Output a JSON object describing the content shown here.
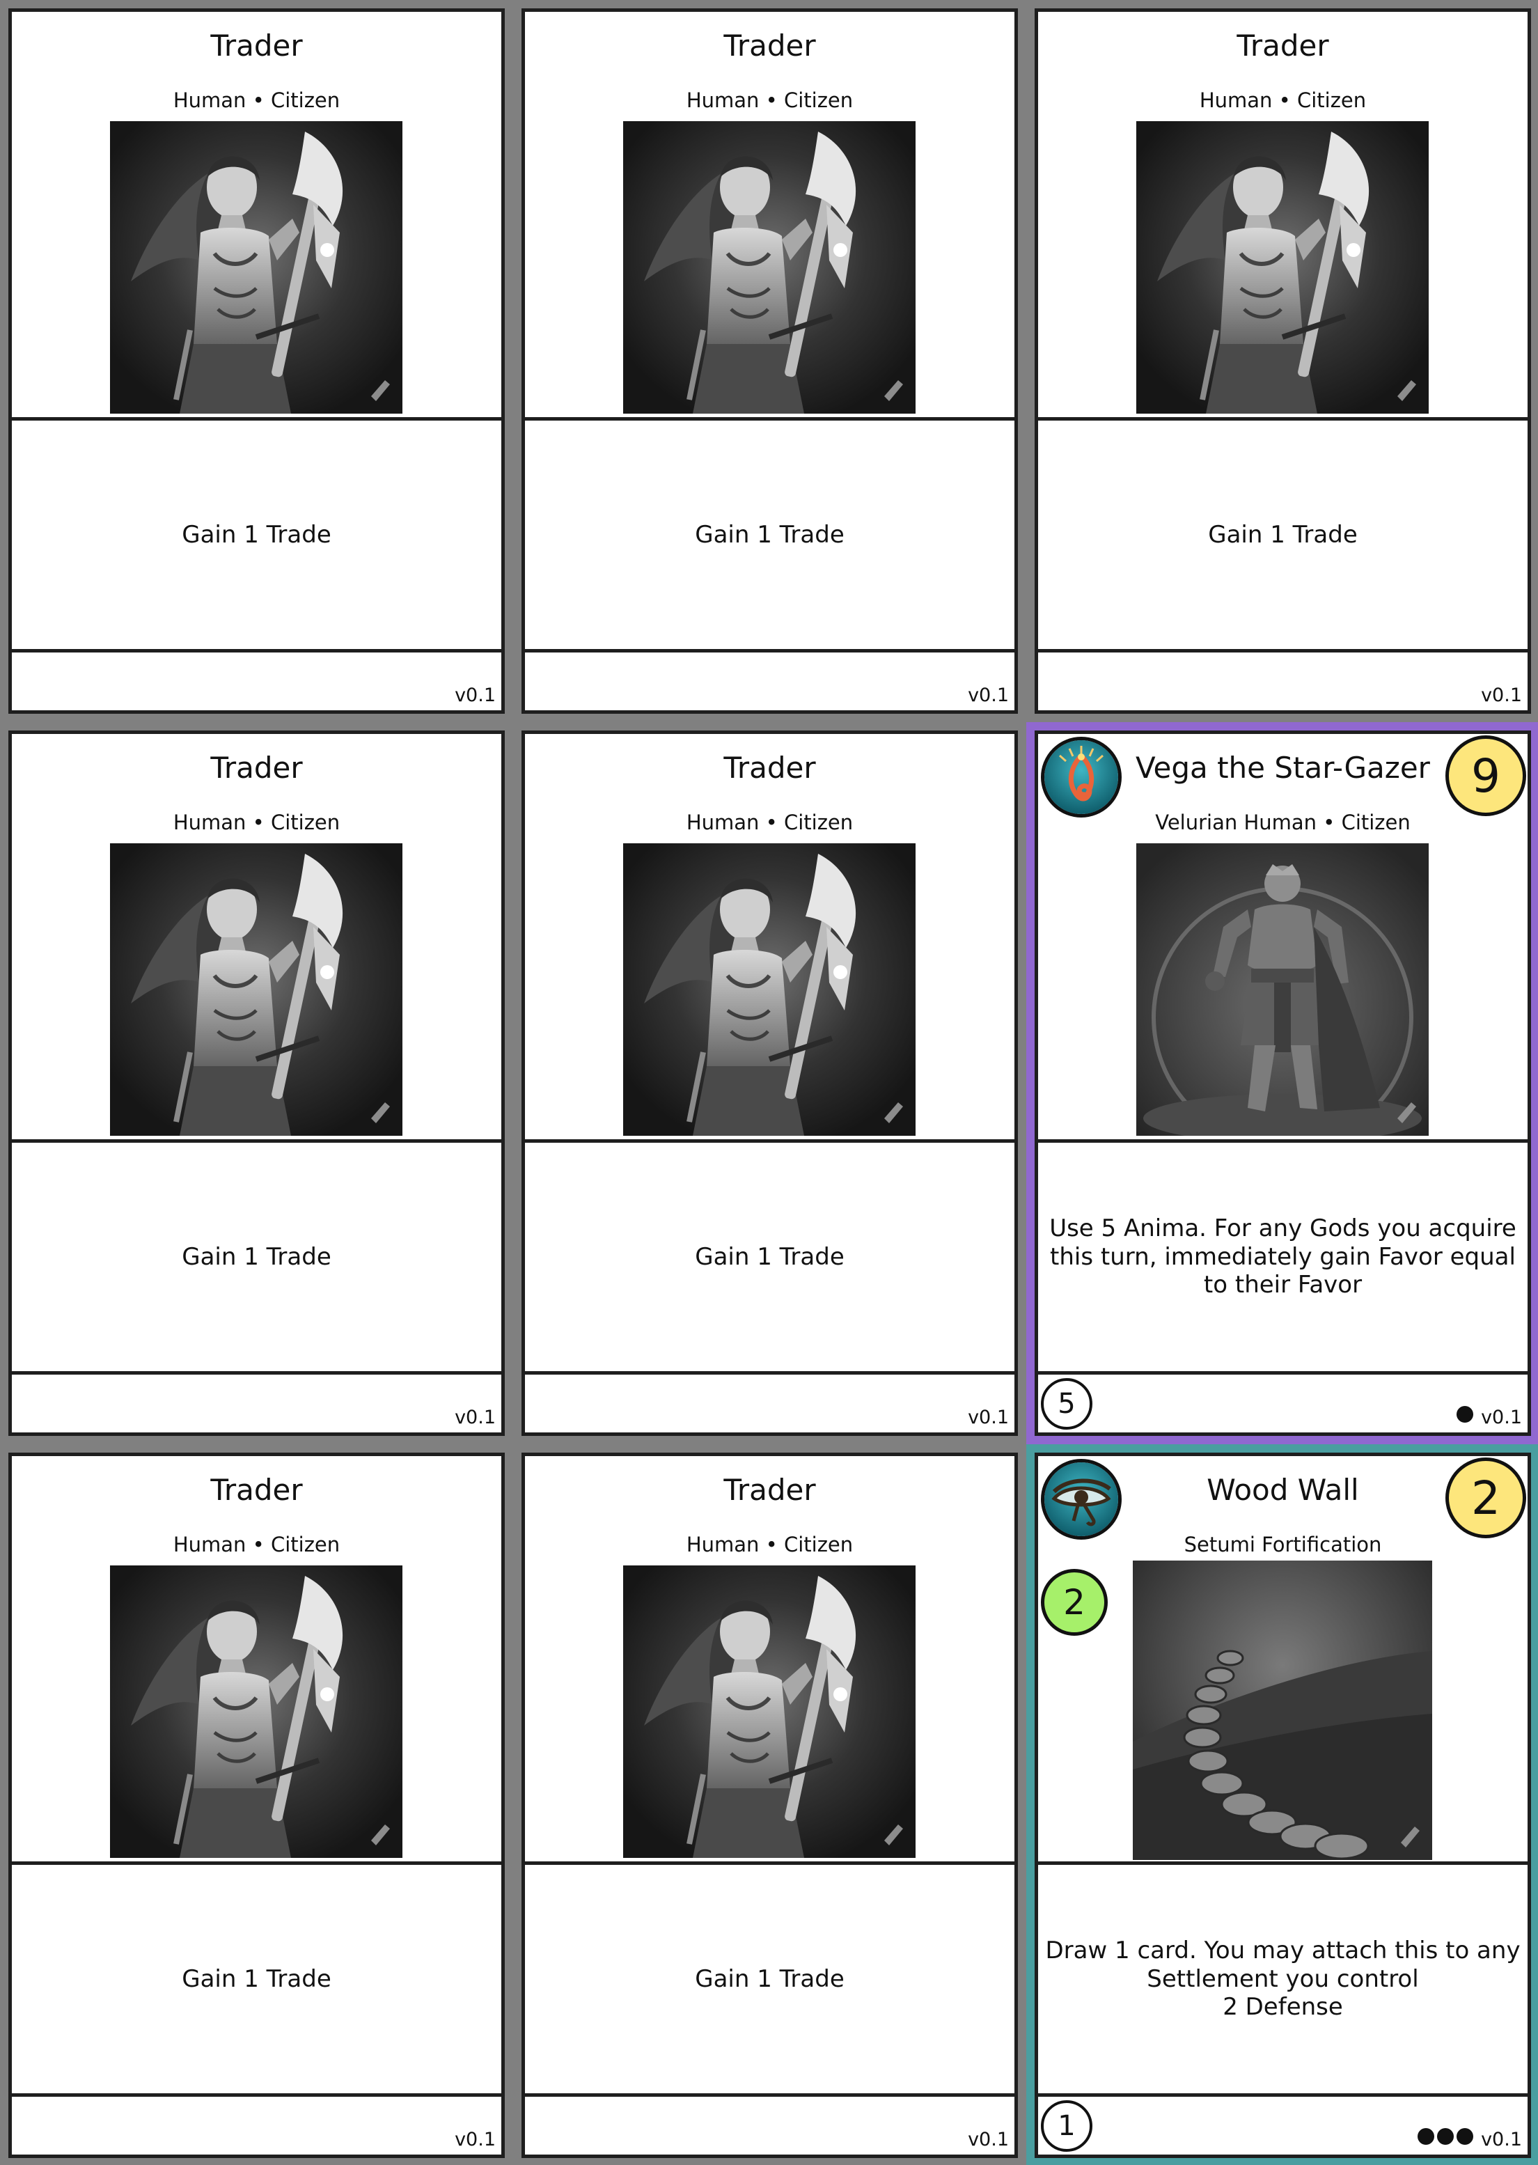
{
  "cards": [
    {
      "title": "Trader",
      "subtitle": "Human • Citizen",
      "text": "Gain 1 Trade",
      "version": "v0.1",
      "art": "woman-warrior-with-axe"
    },
    {
      "title": "Trader",
      "subtitle": "Human • Citizen",
      "text": "Gain 1 Trade",
      "version": "v0.1",
      "art": "woman-warrior-with-axe"
    },
    {
      "title": "Trader",
      "subtitle": "Human • Citizen",
      "text": "Gain 1 Trade",
      "version": "v0.1",
      "art": "woman-warrior-with-axe"
    },
    {
      "title": "Trader",
      "subtitle": "Human • Citizen",
      "text": "Gain 1 Trade",
      "version": "v0.1",
      "art": "woman-warrior-with-axe"
    },
    {
      "title": "Trader",
      "subtitle": "Human • Citizen",
      "text": "Gain 1 Trade",
      "version": "v0.1",
      "art": "woman-warrior-with-axe"
    },
    {
      "title": "Vega the Star-Gazer",
      "subtitle": "Velurian Human • Citizen",
      "text": "Use 5 Anima. For any Gods you acquire this turn, immediately gain Favor equal to their Favor",
      "version": "v0.1",
      "cost": "9",
      "bottom_number": "5",
      "dot_count": 1,
      "border_color": "#9068d0",
      "faction_icon": "velurian-spiral-icon",
      "art": "male-warrior-standing"
    },
    {
      "title": "Trader",
      "subtitle": "Human • Citizen",
      "text": "Gain 1 Trade",
      "version": "v0.1",
      "art": "woman-warrior-with-axe"
    },
    {
      "title": "Trader",
      "subtitle": "Human • Citizen",
      "text": "Gain 1 Trade",
      "version": "v0.1",
      "art": "woman-warrior-with-axe"
    },
    {
      "title": "Wood Wall",
      "subtitle": "Setumi Fortification",
      "text": "Draw 1 card. You may attach this to any Settlement you control\n2 Defense",
      "version": "v0.1",
      "cost": "2",
      "green_value": "2",
      "bottom_number": "1",
      "dot_count": 3,
      "border_color": "#4a9ea0",
      "faction_icon": "setumi-eye-icon",
      "art": "stone-wall-path"
    }
  ]
}
